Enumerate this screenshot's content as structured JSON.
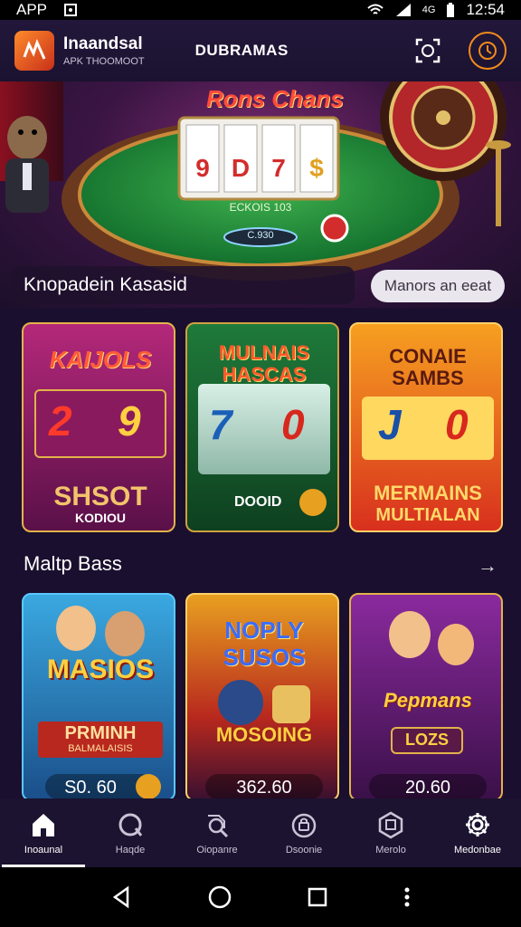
{
  "status_bar": {
    "app_label": "APP",
    "time": "12:54",
    "network": "4G"
  },
  "header": {
    "brand_name": "Inaandsal",
    "brand_sub": "APK THOOMOOT",
    "center_title": "DUBRAMAS"
  },
  "hero": {
    "sign_text": "Rons Chans",
    "reels": [
      "9",
      "D",
      "7",
      "$"
    ],
    "table_text": "ECKOIS 103",
    "chip_text": "C.930",
    "caption": "Knopadein Kasasid",
    "button": "Manors an eeat"
  },
  "games_row1": [
    {
      "title": "KAIJOLS",
      "n1": "2",
      "n2": "9",
      "bottom1": "SHSOT",
      "bottom2": "KODIOU"
    },
    {
      "title": "MULNAIS HASCAS",
      "n1": "7",
      "n2": "0",
      "bottom1": "DOOID"
    },
    {
      "title": "CONAIE SAMBS",
      "n1": "J",
      "n2": "0",
      "bottom1": "MERMAINS",
      "bottom2": "MULTIALAN"
    }
  ],
  "section2": {
    "title": "Maltp Bass",
    "arrow": "→"
  },
  "games_row2": [
    {
      "title": "MASIOS",
      "banner": "PRMINH",
      "banner_sub": "BALMALAISIS",
      "price": "S0. 60"
    },
    {
      "title": "NOPLY SUSOS",
      "banner": "MOSOING",
      "price": "362.60"
    },
    {
      "title": "Pepmans",
      "banner": "LOZS",
      "price": "20.60"
    }
  ],
  "bottom_nav": [
    {
      "label": "Inoaunal",
      "icon": "home-icon",
      "active": true
    },
    {
      "label": "Haqde",
      "icon": "refresh-icon",
      "active": false
    },
    {
      "label": "Oiopanre",
      "icon": "search-icon",
      "active": false
    },
    {
      "label": "Dsoonie",
      "icon": "lock-icon",
      "active": false
    },
    {
      "label": "Merolo",
      "icon": "hexagon-icon",
      "active": false
    },
    {
      "label": "Medonbae",
      "icon": "gear-icon",
      "active": false
    }
  ],
  "colors": {
    "accent": "#f08a1c",
    "background": "#1a0f2e",
    "nav_bg": "#1b1330"
  }
}
